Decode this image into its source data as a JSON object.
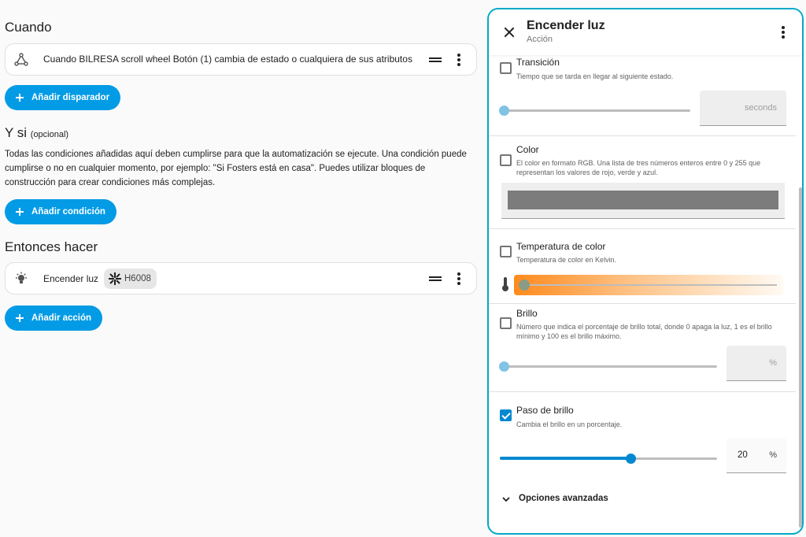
{
  "when": {
    "title": "Cuando",
    "trigger_text": "Cuando BILRESA scroll wheel Botón (1) cambia de estado o cualquiera de sus atributos",
    "add_trigger_label": "Añadir disparador"
  },
  "if": {
    "title": "Y si",
    "optional_label": "(opcional)",
    "description": "Todas las condiciones añadidas aquí deben cumplirse para que la automatización se ejecute. Una condición puede cumplirse o no en cualquier momento, por ejemplo: \"Si Fosters está en casa\". Puedes utilizar bloques de construcción para crear condiciones más complejas.",
    "add_condition_label": "Añadir condición"
  },
  "then": {
    "title": "Entonces hacer",
    "action_text": "Encender luz",
    "chip_label": "H6008",
    "add_action_label": "Añadir acción"
  },
  "dialog": {
    "title": "Encender luz",
    "subtitle": "Acción",
    "transition": {
      "title": "Transición",
      "description": "Tiempo que se tarda en llegar al siguiente estado.",
      "unit": "seconds",
      "checked": false,
      "slider_value": 0
    },
    "color": {
      "title": "Color",
      "description": "El color en formato RGB. Una lista de tres números enteros entre 0 y 255 que representan los valores de rojo, verde y azul.",
      "checked": false,
      "swatch": "#7c7c7c"
    },
    "color_temp": {
      "title": "Temperatura de color",
      "description": "Temperatura de color en Kelvin.",
      "checked": false,
      "gradient_start": "#ff8a1c",
      "gradient_end": "#fffaf3"
    },
    "brightness": {
      "title": "Brillo",
      "description": "Número que indica el porcentaje de brillo total, donde 0 apaga la luz, 1 es el brillo mínimo y 100 es el brillo máximo.",
      "unit": "%",
      "checked": false,
      "slider_value": 0
    },
    "brightness_step": {
      "title": "Paso de brillo",
      "description": "Cambia el brillo en un porcentaje.",
      "unit": "%",
      "value": "20",
      "checked": true,
      "slider_fraction": 0.6
    },
    "advanced_label": "Opciones avanzadas"
  },
  "colors": {
    "accent": "#039be5",
    "dialog_border": "#03a9c7",
    "checkbox_checked": "#0288d1"
  }
}
